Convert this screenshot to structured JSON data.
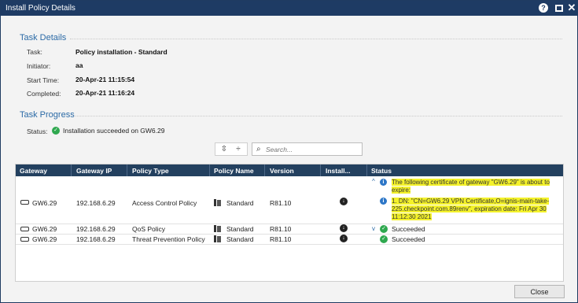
{
  "window": {
    "title": "Install Policy Details",
    "help_icon": "help-icon",
    "maximize_icon": "maximize-icon",
    "close_icon": "close-icon"
  },
  "task_details": {
    "heading": "Task Details",
    "fields": [
      {
        "label": "Task:",
        "value": "Policy installation - Standard"
      },
      {
        "label": "Initiator:",
        "value": "aa"
      },
      {
        "label": "Start Time:",
        "value": "20-Apr-21 11:15:54"
      },
      {
        "label": "Completed:",
        "value": "20-Apr-21 11:16:24"
      }
    ]
  },
  "task_progress": {
    "heading": "Task Progress",
    "status_label": "Status:",
    "status_text": "Installation succeeded on GW6.29"
  },
  "toolbar": {
    "expand_all_icon": "expand-all-icon",
    "collapse_all_icon": "collapse-all-icon",
    "search_placeholder": "Search..."
  },
  "table": {
    "columns": [
      "Gateway",
      "Gateway IP",
      "Policy Type",
      "Policy Name",
      "Version",
      "Install...",
      "Status"
    ],
    "rows": [
      {
        "gateway": "GW6.29",
        "ip": "192.168.6.29",
        "policy_type": "Access Control Policy",
        "policy_name": "Standard",
        "version": "R81.10",
        "status_lines": [
          "The following certificate of gateway \"GW6.29\" is about to expire:",
          "1. DN: \"CN=GW6.29 VPN Certificate,O=ignis-main-take-225.checkpoint.com.89renv\", expiration date: Fri Apr 30 11:12:30 2021"
        ]
      },
      {
        "gateway": "GW6.29",
        "ip": "192.168.6.29",
        "policy_type": "QoS Policy",
        "policy_name": "Standard",
        "version": "R81.10",
        "status": "Succeeded"
      },
      {
        "gateway": "GW6.29",
        "ip": "192.168.6.29",
        "policy_type": "Threat Prevention Policy",
        "policy_name": "Standard",
        "version": "R81.10",
        "status": "Succeeded"
      }
    ]
  },
  "footer": {
    "close_label": "Close"
  },
  "colors": {
    "titlebar": "#1e3b64",
    "header": "#23405f",
    "accent": "#2b6aa6",
    "success": "#2fa84f",
    "highlight": "#f4f22a"
  }
}
